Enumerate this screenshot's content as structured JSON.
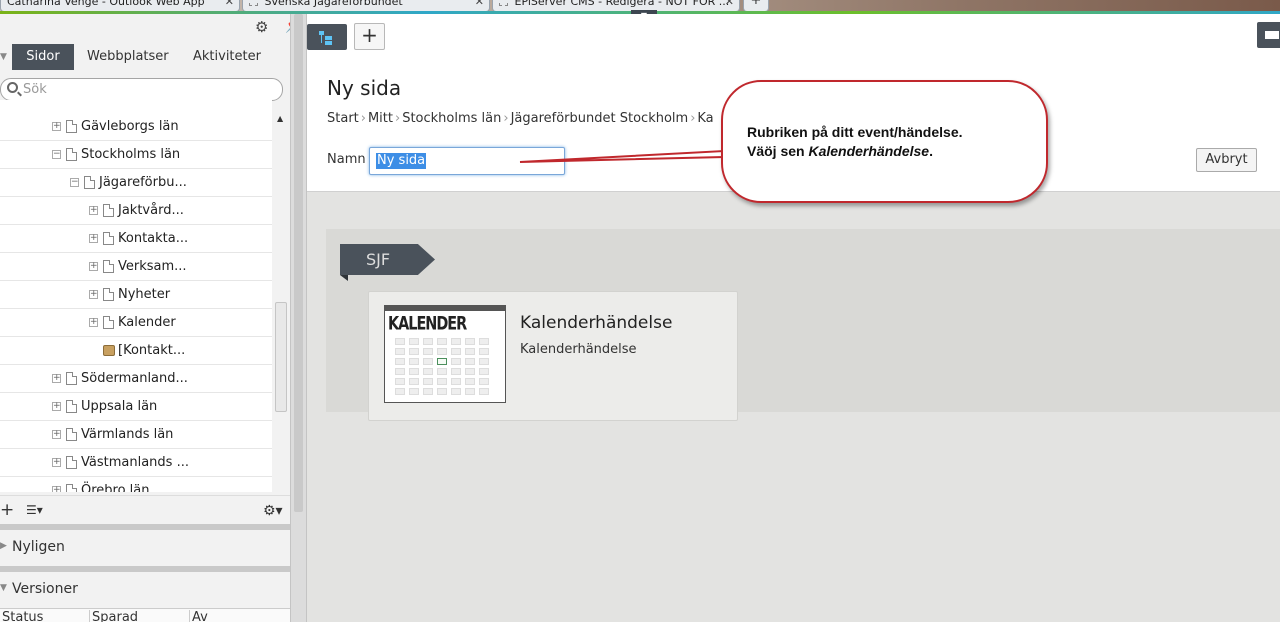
{
  "browser": {
    "tabs": [
      {
        "label": "Catharina Venge - Outlook Web App"
      },
      {
        "label": "Svenska Jägareförbundet"
      },
      {
        "label": "EPiServer CMS - Redigera - NOT FOR ..."
      }
    ],
    "new_tab": "+"
  },
  "left_pane": {
    "tabs": [
      "Sidor",
      "Webbplatser",
      "Aktiviteter"
    ],
    "active_tab": "Sidor",
    "search_placeholder": "Sök",
    "tree": [
      {
        "label": "Gävleborgs län",
        "level": 1,
        "expander": "+",
        "icon": "page"
      },
      {
        "label": "Stockholms län",
        "level": 1,
        "expander": "−",
        "icon": "page"
      },
      {
        "label": "Jägareförbu...",
        "level": 2,
        "expander": "−",
        "icon": "page"
      },
      {
        "label": "Jaktvård...",
        "level": 3,
        "expander": "+",
        "icon": "page"
      },
      {
        "label": "Kontakta...",
        "level": 3,
        "expander": "+",
        "icon": "page"
      },
      {
        "label": "Verksam...",
        "level": 3,
        "expander": "+",
        "icon": "page"
      },
      {
        "label": "Nyheter",
        "level": 3,
        "expander": "+",
        "icon": "page"
      },
      {
        "label": "Kalender",
        "level": 3,
        "expander": "+",
        "icon": "page"
      },
      {
        "label": "[Kontakt...",
        "level": 3,
        "expander": "",
        "icon": "block"
      },
      {
        "label": "Södermanland...",
        "level": 1,
        "expander": "+",
        "icon": "page"
      },
      {
        "label": "Uppsala län",
        "level": 1,
        "expander": "+",
        "icon": "page"
      },
      {
        "label": "Värmlands län",
        "level": 1,
        "expander": "+",
        "icon": "page"
      },
      {
        "label": "Västmanlands ...",
        "level": 1,
        "expander": "+",
        "icon": "page"
      },
      {
        "label": "Örebro län",
        "level": 1,
        "expander": "+",
        "icon": "page"
      }
    ],
    "sections": {
      "recent": "Nyligen",
      "versions": "Versioner"
    },
    "version_columns": [
      "Status",
      "Sparad",
      "Av"
    ]
  },
  "main": {
    "title": "Ny sida",
    "breadcrumb": [
      "Start",
      "Mitt",
      "Stockholms län",
      "Jägareförbundet Stockholm",
      "Ka"
    ],
    "name_label": "Namn",
    "name_value": "Ny sida",
    "cancel_label": "Avbryt",
    "category": "SJF",
    "page_type": {
      "thumb_title": "KALENDER",
      "name": "Kalenderhändelse",
      "description": "Kalenderhändelse"
    }
  },
  "callout": {
    "line1": "Rubriken på ditt event/händelse.",
    "line2_prefix": "Väöj sen ",
    "line2_emphasis": "Kalenderhändelse",
    "line2_suffix": "."
  },
  "colors": {
    "toolbar_dark": "#4a525b",
    "accent_blue": "#1b7bc1",
    "callout_border": "#c0282d",
    "selection": "#3d8ee6"
  }
}
